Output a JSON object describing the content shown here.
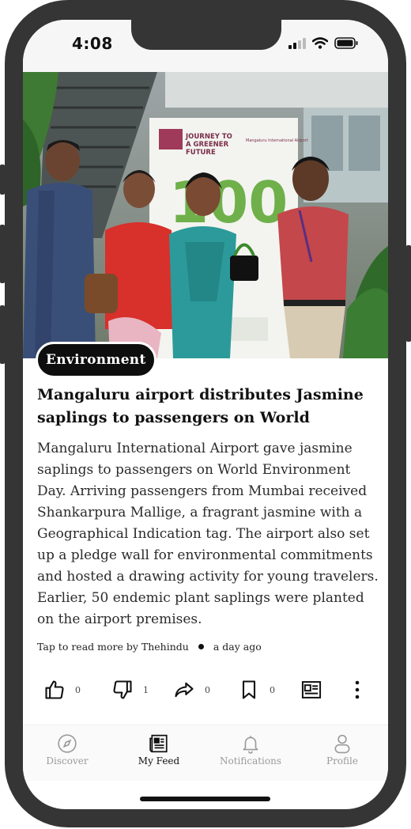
{
  "status_bar": {
    "time": "4:08"
  },
  "article": {
    "category": "Environment",
    "headline": "Mangaluru airport distributes Jasmine saplings to passengers on World",
    "summary": "Mangaluru International Airport gave jasmine saplings to passengers on World Environment Day. Arriving passengers from Mumbai received Shankarpura Mallige, a fragrant jasmine with a Geographical Indication tag. The airport also set up a pledge wall for environmental commitments and hosted a drawing activity for young travelers. Earlier, 50 endemic plant saplings were planted on the airport premises.",
    "source_text": "Tap to read more by Thehindu",
    "time_ago": "a day ago",
    "photo": {
      "banner_line1": "JOURNEY TO",
      "banner_line2": "A GREENER",
      "banner_line3": "FUTURE",
      "banner_airport": "Mangaluru International Airport",
      "banner_big": "100"
    }
  },
  "actions": {
    "like_count": "0",
    "dislike_count": "1",
    "share_count": "0",
    "bookmark_count": "0"
  },
  "nav": {
    "items": [
      {
        "label": "Discover",
        "icon": "compass-icon",
        "active": false
      },
      {
        "label": "My Feed",
        "icon": "newspaper-icon",
        "active": true
      },
      {
        "label": "Notifications",
        "icon": "bell-icon",
        "active": false
      },
      {
        "label": "Profile",
        "icon": "person-icon",
        "active": false
      }
    ]
  },
  "colors": {
    "frame": "#353535",
    "tag_bg": "#0e0e0e",
    "active_nav": "#111111",
    "inactive_nav": "#9a9a9a"
  }
}
